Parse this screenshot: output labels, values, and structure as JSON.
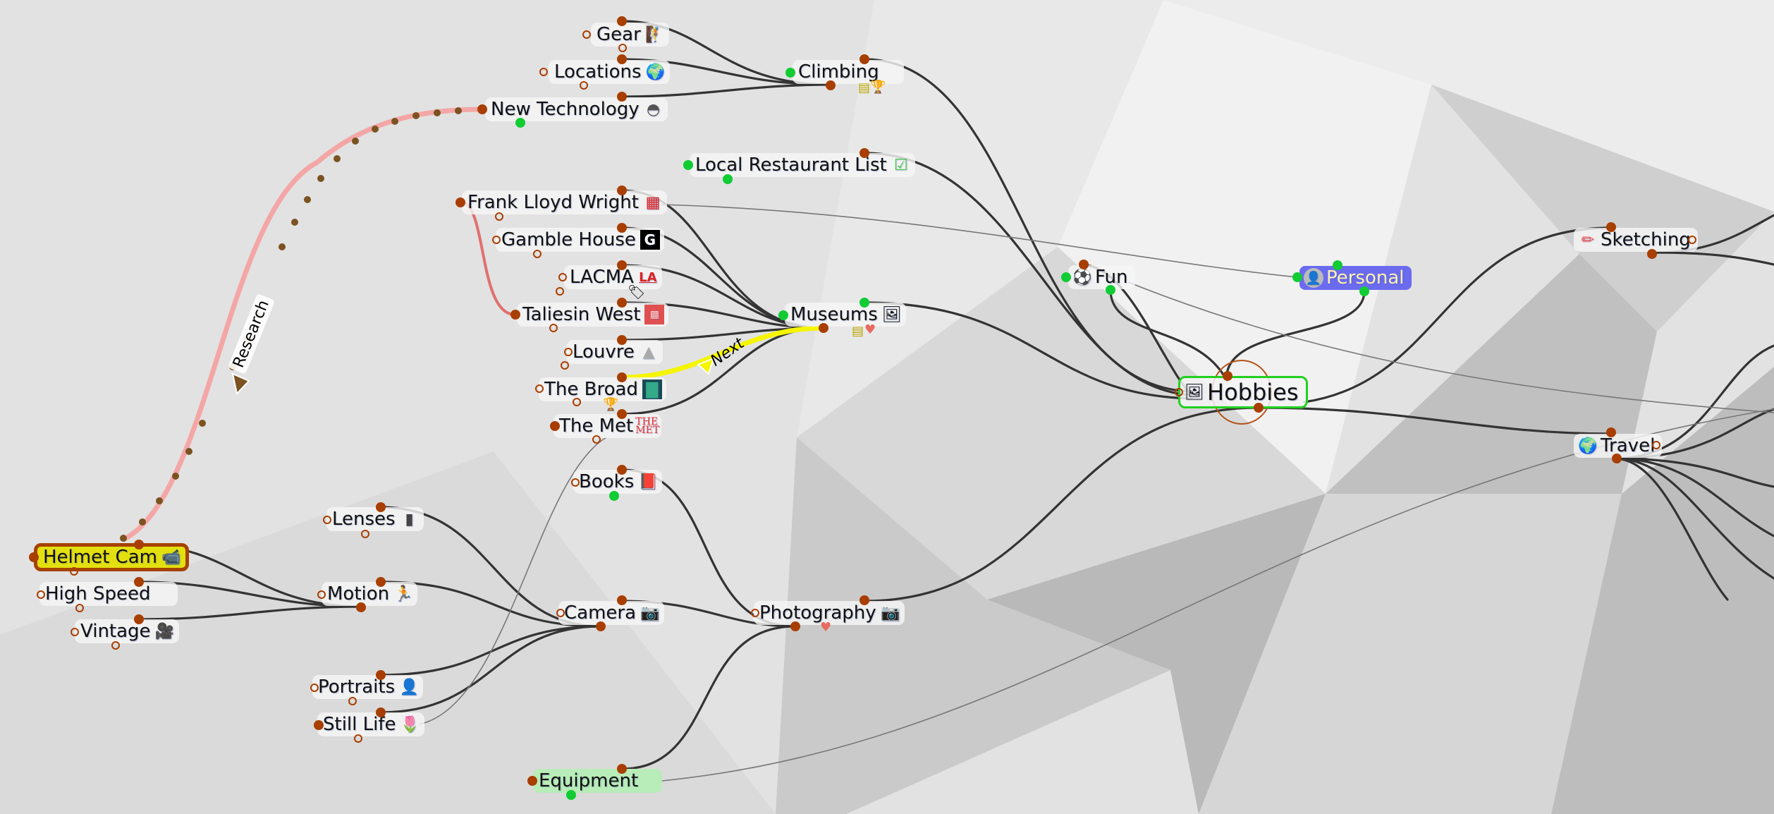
{
  "map": {
    "root": "Hobbies",
    "nodes": [
      {
        "id": "gear",
        "label": "Gear",
        "icon": "climber-icon",
        "glyph": "🧗"
      },
      {
        "id": "locations",
        "label": "Locations",
        "icon": "globe-pin-icon",
        "glyph": "🌍"
      },
      {
        "id": "new_technology",
        "label": "New Technology",
        "icon": "speedometer-icon",
        "glyph": "⏲"
      },
      {
        "id": "climbing",
        "label": "Climbing",
        "icon": "",
        "glyph": ""
      },
      {
        "id": "local_restaurant_list",
        "label": "Local Restaurant List",
        "icon": "checklist-icon",
        "glyph": "☑"
      },
      {
        "id": "frank_lloyd_wright",
        "label": "Frank Lloyd Wright",
        "icon": "flw-logo-icon",
        "glyph": "▦"
      },
      {
        "id": "gamble_house",
        "label": "Gamble House",
        "icon": "g-logo-icon",
        "glyph": "G"
      },
      {
        "id": "lacma",
        "label": "LACMA",
        "icon": "la-logo-icon",
        "glyph": "LA"
      },
      {
        "id": "taliesin_west",
        "label": "Taliesin West",
        "icon": "taliesin-logo-icon",
        "glyph": "▩"
      },
      {
        "id": "louvre",
        "label": "Louvre",
        "icon": "pyramid-icon",
        "glyph": "△"
      },
      {
        "id": "the_broad",
        "label": "The Broad",
        "icon": "broad-art-icon",
        "glyph": "▇"
      },
      {
        "id": "the_met",
        "label": "The Met",
        "icon": "met-logo-icon",
        "glyph": "M"
      },
      {
        "id": "museums",
        "label": "Museums",
        "icon": "framed-picture-icon",
        "glyph": "🖼"
      },
      {
        "id": "fun",
        "label": "Fun",
        "icon": "soccer-ball-icon",
        "glyph": "⚽"
      },
      {
        "id": "personal",
        "label": "Personal",
        "icon": "person-avatar-icon",
        "glyph": "👤"
      },
      {
        "id": "hobbies",
        "label": "Hobbies",
        "icon": "easel-painting-icon",
        "glyph": "🖼"
      },
      {
        "id": "sketching",
        "label": "Sketching",
        "icon": "pencil-icon",
        "glyph": "✏"
      },
      {
        "id": "travel",
        "label": "Travel",
        "icon": "globe-pin-icon",
        "glyph": "🌍"
      },
      {
        "id": "books",
        "label": "Books",
        "icon": "book-icon",
        "glyph": "📕"
      },
      {
        "id": "lenses",
        "label": "Lenses",
        "icon": "lens-icon",
        "glyph": "▮"
      },
      {
        "id": "helmet_cam",
        "label": "Helmet Cam",
        "icon": "video-camera-icon",
        "glyph": "📹"
      },
      {
        "id": "high_speed",
        "label": "High Speed",
        "icon": "",
        "glyph": ""
      },
      {
        "id": "vintage",
        "label": "Vintage",
        "icon": "film-camera-icon",
        "glyph": "🎥"
      },
      {
        "id": "motion",
        "label": "Motion",
        "icon": "runner-icon",
        "glyph": "🏃"
      },
      {
        "id": "camera",
        "label": "Camera",
        "icon": "camera-icon",
        "glyph": "📷"
      },
      {
        "id": "photography",
        "label": "Photography",
        "icon": "camera-icon",
        "glyph": "📷"
      },
      {
        "id": "portraits",
        "label": "Portraits",
        "icon": "portrait-icon",
        "glyph": "👤"
      },
      {
        "id": "still_life",
        "label": "Still Life",
        "icon": "tulip-icon",
        "glyph": "🌷"
      },
      {
        "id": "equipment",
        "label": "Equipment",
        "icon": "",
        "glyph": ""
      }
    ],
    "relationship_labels": {
      "research": "Research",
      "next": "Next"
    },
    "colors": {
      "node_dot": "#a83e00",
      "connected_dot": "#11cc33",
      "helmet_fill": "#e3e00f",
      "personal_fill": "#6b6bf0",
      "personal_text": "#fff3b0",
      "hobbies_border": "#22d022",
      "equipment_fill": "#b8ecb8",
      "research_line": "#f4a6a6",
      "next_line": "#f5f500",
      "branch_line": "#333333"
    }
  }
}
